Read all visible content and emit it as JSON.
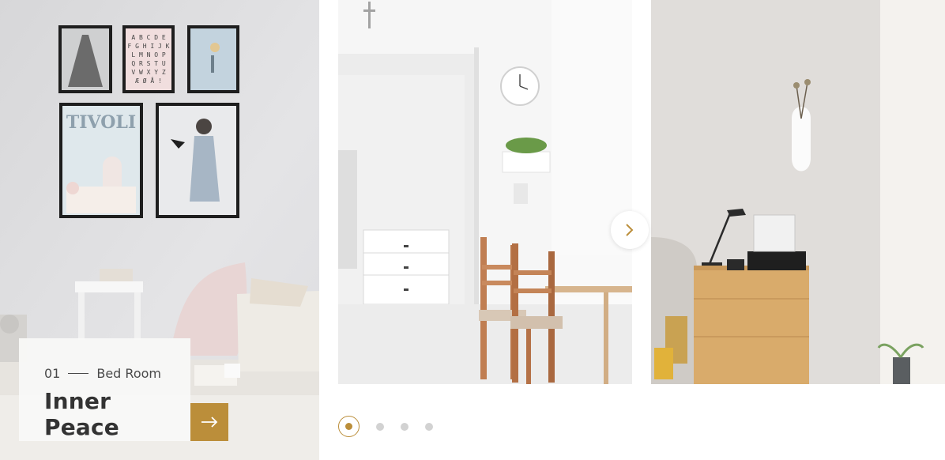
{
  "slides": [
    {
      "number": "01",
      "category": "Bed Room",
      "title": "Inner Peace",
      "poster_text": "TIVOLI",
      "alphabet_rows": [
        "A B C D E",
        "F G H I J K",
        "L M N O P",
        "Q R S T U",
        "V W X Y Z",
        "Æ Ø Å !"
      ]
    }
  ],
  "slider": {
    "dot_count": 4,
    "active_dot": 1
  },
  "icons": {
    "caption_arrow": "arrow-right-icon",
    "next": "chevron-right-icon"
  },
  "colors": {
    "accent": "#bb8e3a",
    "dot_inactive": "#d2d2d2"
  }
}
